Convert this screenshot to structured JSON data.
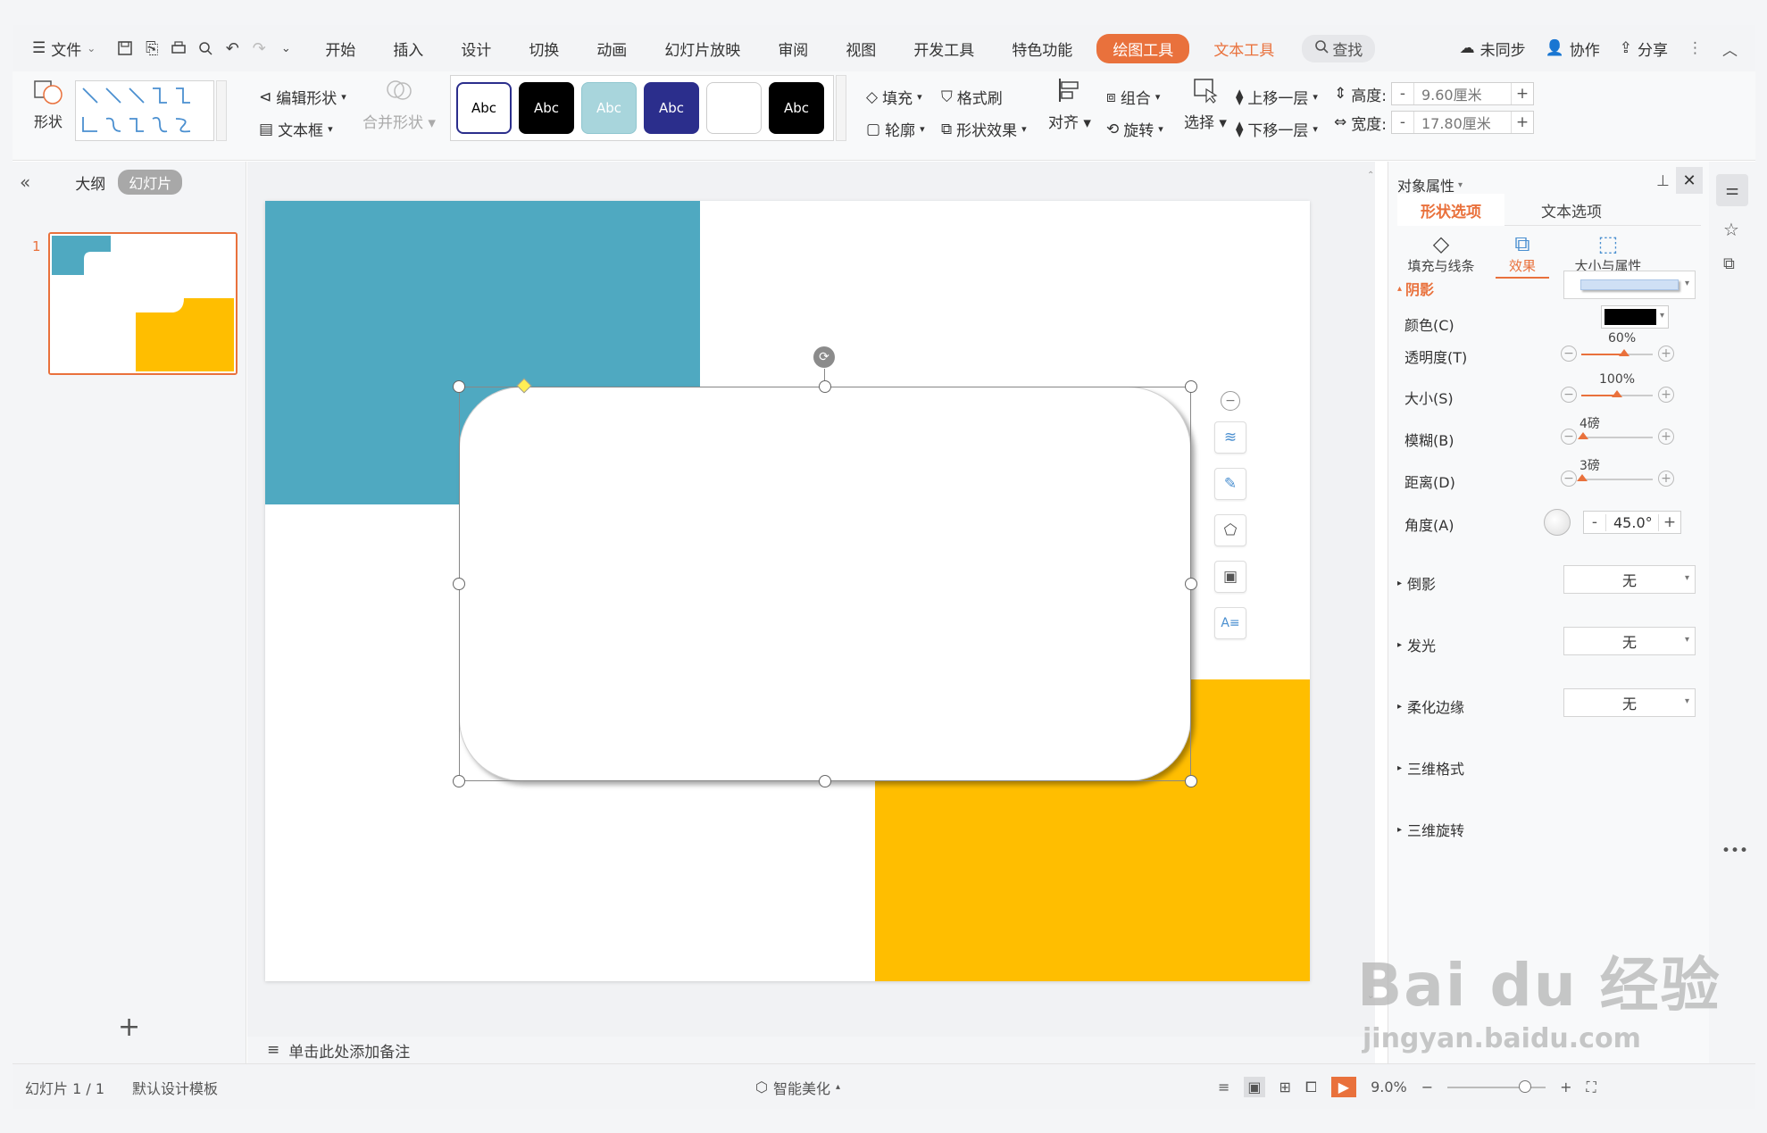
{
  "menubar": {
    "file_label": "文件",
    "tabs": [
      "开始",
      "插入",
      "设计",
      "切换",
      "动画",
      "幻灯片放映",
      "审阅",
      "视图",
      "开发工具",
      "特色功能"
    ],
    "drawing_tools": "绘图工具",
    "text_tools": "文本工具",
    "search": "查找",
    "sync": "未同步",
    "collab": "协作",
    "share": "分享"
  },
  "ribbon": {
    "shape_label": "形状",
    "edit_shape": "编辑形状",
    "textbox": "文本框",
    "merge_shape": "合并形状",
    "style_label": "Abc",
    "fill": "填充",
    "format_painter": "格式刷",
    "outline": "轮廓",
    "shape_effect": "形状效果",
    "align": "对齐",
    "group": "组合",
    "rotate": "旋转",
    "select": "选择",
    "bring_forward": "上移一层",
    "send_backward": "下移一层",
    "height_label": "高度:",
    "height_value": "9.60厘米",
    "width_label": "宽度:",
    "width_value": "17.80厘米",
    "minus": "-",
    "plus": "+"
  },
  "leftpane": {
    "outline_tab": "大纲",
    "slides_tab": "幻灯片",
    "slide_number": "1",
    "add": "+"
  },
  "notes": {
    "placeholder": "单击此处添加备注"
  },
  "rpanel": {
    "title": "对象属性",
    "tab_shape": "形状选项",
    "tab_text": "文本选项",
    "sub_fill": "填充与线条",
    "sub_effect": "效果",
    "sub_size": "大小与属性",
    "shadow": "阴影",
    "color": "颜色(C)",
    "transparency": "透明度(T)",
    "transparency_value": "60%",
    "size": "大小(S)",
    "size_value": "100%",
    "blur": "模糊(B)",
    "blur_value": "4磅",
    "distance": "距离(D)",
    "distance_value": "3磅",
    "angle": "角度(A)",
    "angle_value": "45.0°",
    "reflection": "倒影",
    "glow": "发光",
    "soft_edge": "柔化边缘",
    "none": "无",
    "threed_format": "三维格式",
    "threed_rotation": "三维旋转"
  },
  "statusbar": {
    "slide_info": "幻灯片 1 / 1",
    "template": "默认设计模板",
    "smart": "智能美化",
    "zoom": "9.0%"
  },
  "watermark": {
    "brand": "Bai du 经验",
    "url": "jingyan.baidu.com"
  },
  "colors": {
    "accent": "#e9713c",
    "teal": "#4fa9c1",
    "yellow": "#ffbe00",
    "navy": "#2b2e8c"
  }
}
